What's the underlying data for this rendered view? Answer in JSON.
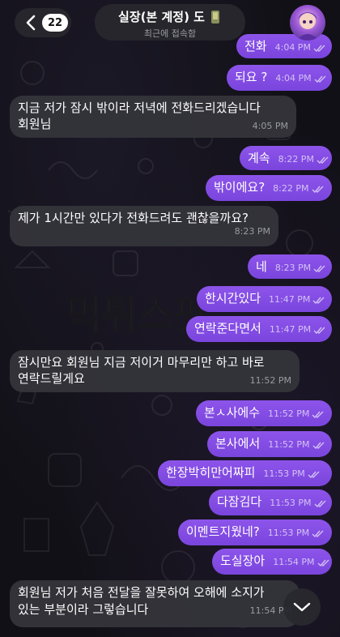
{
  "header": {
    "back_count": "22",
    "title": "실장(본 계정) 도",
    "status": "최근에 접속함"
  },
  "watermark_text": "먹튀스팟",
  "messages": [
    {
      "dir": "out",
      "text": "전화",
      "time": "4:04 PM"
    },
    {
      "dir": "out",
      "text": "되요 ?",
      "time": "4:04 PM"
    },
    {
      "dir": "in",
      "lines": [
        "지금 저가 잠시 밖이라 저녁에 전화드리겠습니다",
        "회원님"
      ],
      "time": "4:05 PM"
    },
    {
      "dir": "out",
      "text": "계속",
      "time": "8:22 PM"
    },
    {
      "dir": "out",
      "text": "밖이에요?",
      "time": "8:22 PM"
    },
    {
      "dir": "in",
      "lines": [
        "제가 1시간만 있다가 전화드려도 괜찮을까요?"
      ],
      "time": "8:23 PM"
    },
    {
      "dir": "out",
      "text": "네",
      "time": "8:23 PM"
    },
    {
      "dir": "out",
      "text": "한시간있다",
      "time": "11:47 PM"
    },
    {
      "dir": "out",
      "text": "연락준다면서",
      "time": "11:47 PM"
    },
    {
      "dir": "in",
      "lines": [
        "잠시만요 회원님 지금 저이거 마무리만 하고 바로",
        "연락드릴게요"
      ],
      "time": "11:52 PM"
    },
    {
      "dir": "out",
      "text": "본ㅅ사에수",
      "time": "11:52 PM"
    },
    {
      "dir": "out",
      "text": "본사에서",
      "time": "11:52 PM"
    },
    {
      "dir": "out",
      "text": "한장박히만어짜피",
      "time": "11:53 PM"
    },
    {
      "dir": "out",
      "text": "다잠김다",
      "time": "11:53 PM"
    },
    {
      "dir": "out",
      "text": "이멘트지웠네?",
      "time": "11:53 PM"
    },
    {
      "dir": "out",
      "text": "도실장아",
      "time": "11:54 PM"
    },
    {
      "dir": "in",
      "lines": [
        "회원님 저가 처음 전달을 잘못하여 오해에 소지가",
        "있는 부분이라 그렇습니다"
      ],
      "time": "11:54 PM"
    }
  ],
  "colors": {
    "outgoing_bubble": "#8d54ea",
    "incoming_bubble": "#34343a",
    "background": "#111016"
  },
  "icons": [
    "chevron-left-icon",
    "phone-emoji-icon",
    "avatar",
    "double-check-icon",
    "chevron-down-icon"
  ]
}
